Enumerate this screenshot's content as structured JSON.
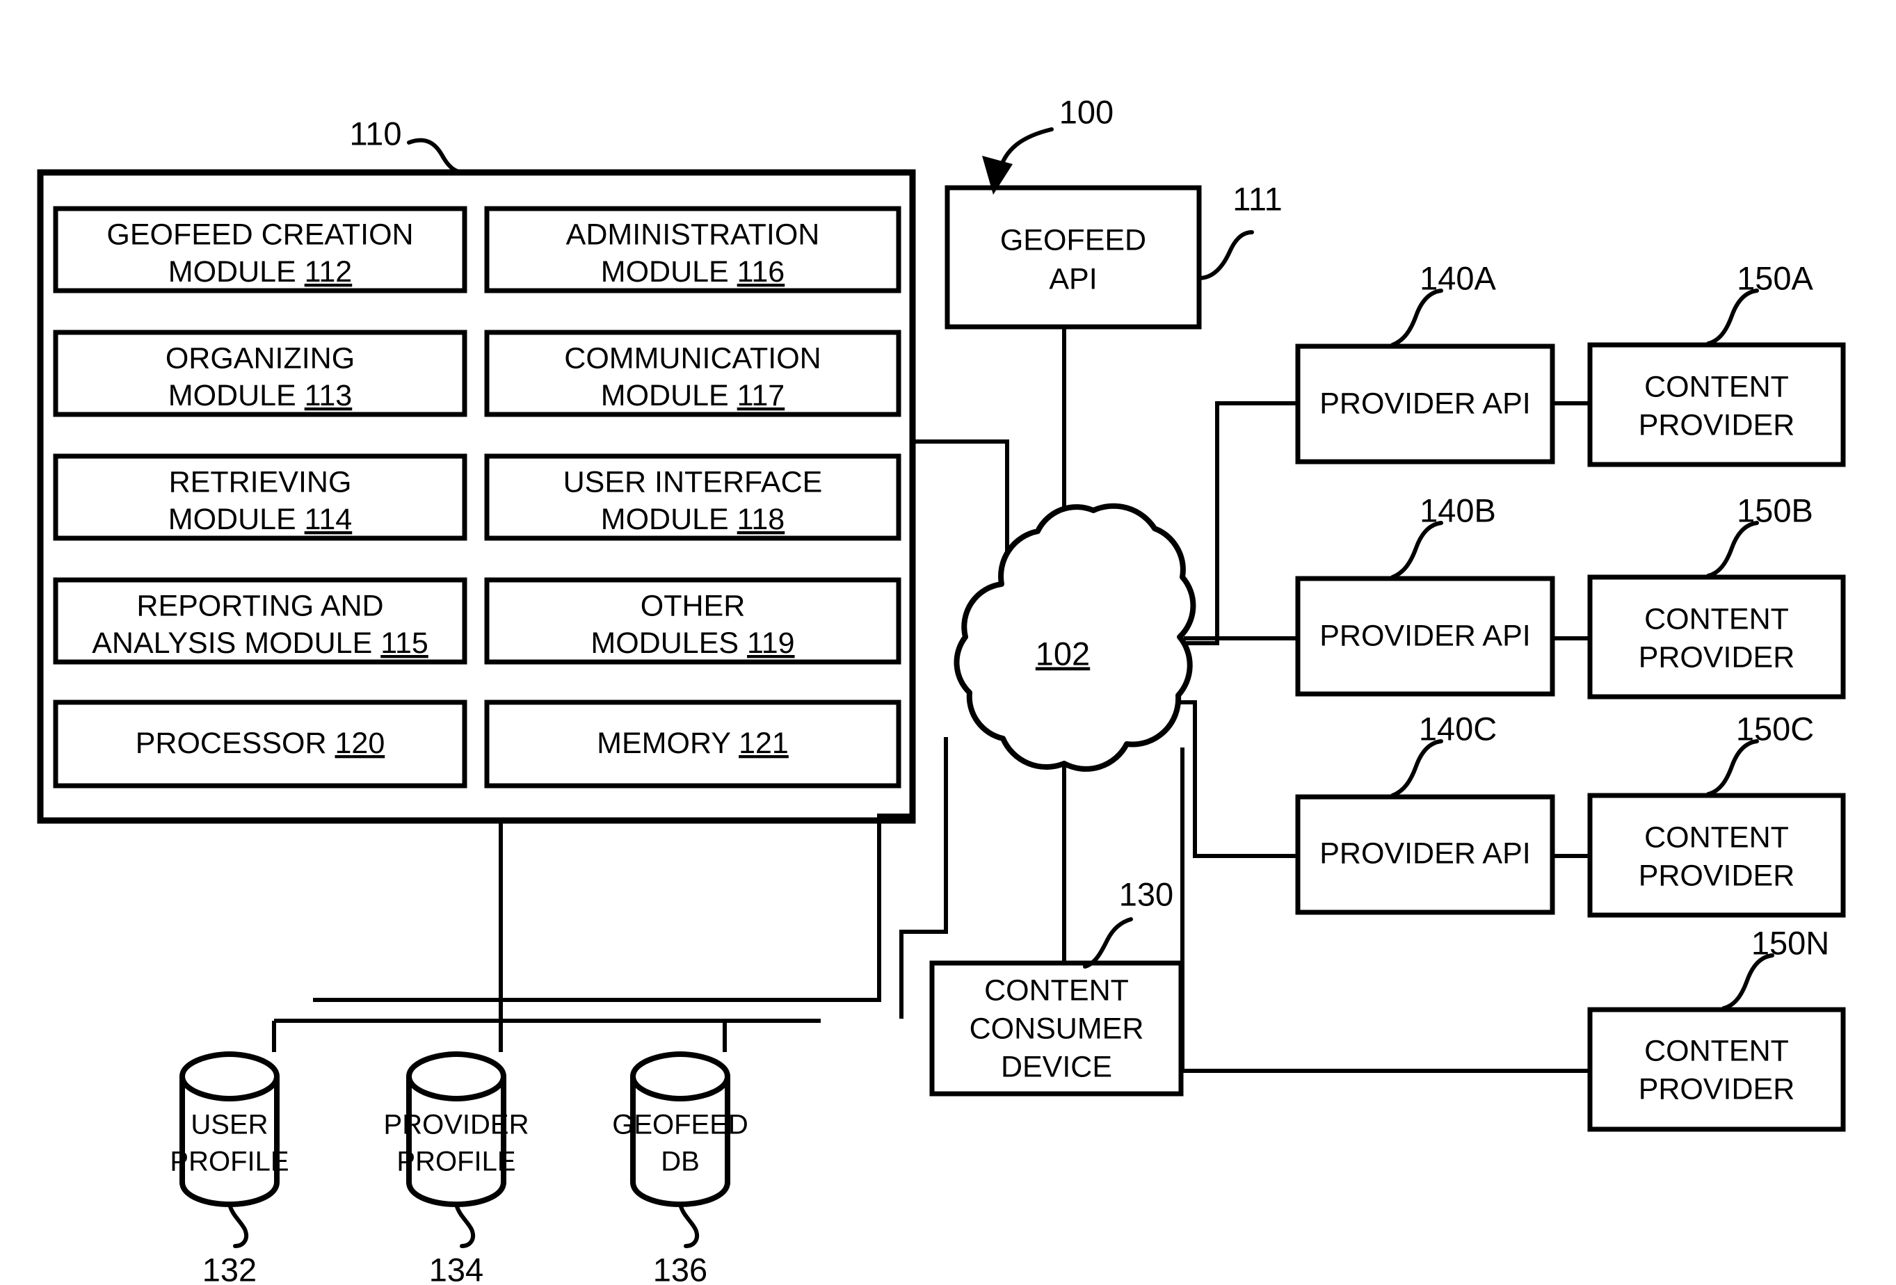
{
  "figure": {
    "title": "Geofeed system block diagram",
    "background_color": "#ffffff",
    "line_color": "#000000"
  },
  "system_box": {
    "ref": "110",
    "modules": [
      {
        "line1": "GEOFEED CREATION",
        "line2": "MODULE ",
        "ref": "112"
      },
      {
        "line1": "ADMINISTRATION",
        "line2": "MODULE ",
        "ref": "116"
      },
      {
        "line1": "ORGANIZING",
        "line2": "MODULE ",
        "ref": "113"
      },
      {
        "line1": "COMMUNICATION",
        "line2": "MODULE ",
        "ref": "117"
      },
      {
        "line1": "RETRIEVING",
        "line2": "MODULE ",
        "ref": "114"
      },
      {
        "line1": "USER INTERFACE",
        "line2": "MODULE ",
        "ref": "118"
      },
      {
        "line1": "REPORTING AND",
        "line2": "ANALYSIS MODULE ",
        "ref": "115"
      },
      {
        "line1": "OTHER",
        "line2": "MODULES ",
        "ref": "119"
      },
      {
        "line1": "",
        "line2": "PROCESSOR ",
        "ref": "120"
      },
      {
        "line1": "",
        "line2": "MEMORY ",
        "ref": "121"
      }
    ]
  },
  "geofeed_api": {
    "line1": "GEOFEED",
    "line2": "API",
    "ref": "111"
  },
  "system_ref_100": "100",
  "network_cloud": {
    "ref": "102"
  },
  "content_consumer_device": {
    "line1": "CONTENT",
    "line2": "CONSUMER",
    "line3": "DEVICE",
    "ref": "130"
  },
  "provider_rows": [
    {
      "api_label": "PROVIDER API",
      "api_ref": "140A",
      "provider_line1": "CONTENT",
      "provider_line2": "PROVIDER",
      "provider_ref": "150A"
    },
    {
      "api_label": "PROVIDER API",
      "api_ref": "140B",
      "provider_line1": "CONTENT",
      "provider_line2": "PROVIDER",
      "provider_ref": "150B"
    },
    {
      "api_label": "PROVIDER API",
      "api_ref": "140C",
      "provider_line1": "CONTENT",
      "provider_line2": "PROVIDER",
      "provider_ref": "150C"
    }
  ],
  "provider_n": {
    "line1": "CONTENT",
    "line2": "PROVIDER",
    "ref": "150N"
  },
  "databases": [
    {
      "line1": "USER",
      "line2": "PROFILE",
      "ref": "132"
    },
    {
      "line1": "PROVIDER",
      "line2": "PROFILE",
      "ref": "134"
    },
    {
      "line1": "GEOFEED",
      "line2": "DB",
      "ref": "136"
    }
  ]
}
